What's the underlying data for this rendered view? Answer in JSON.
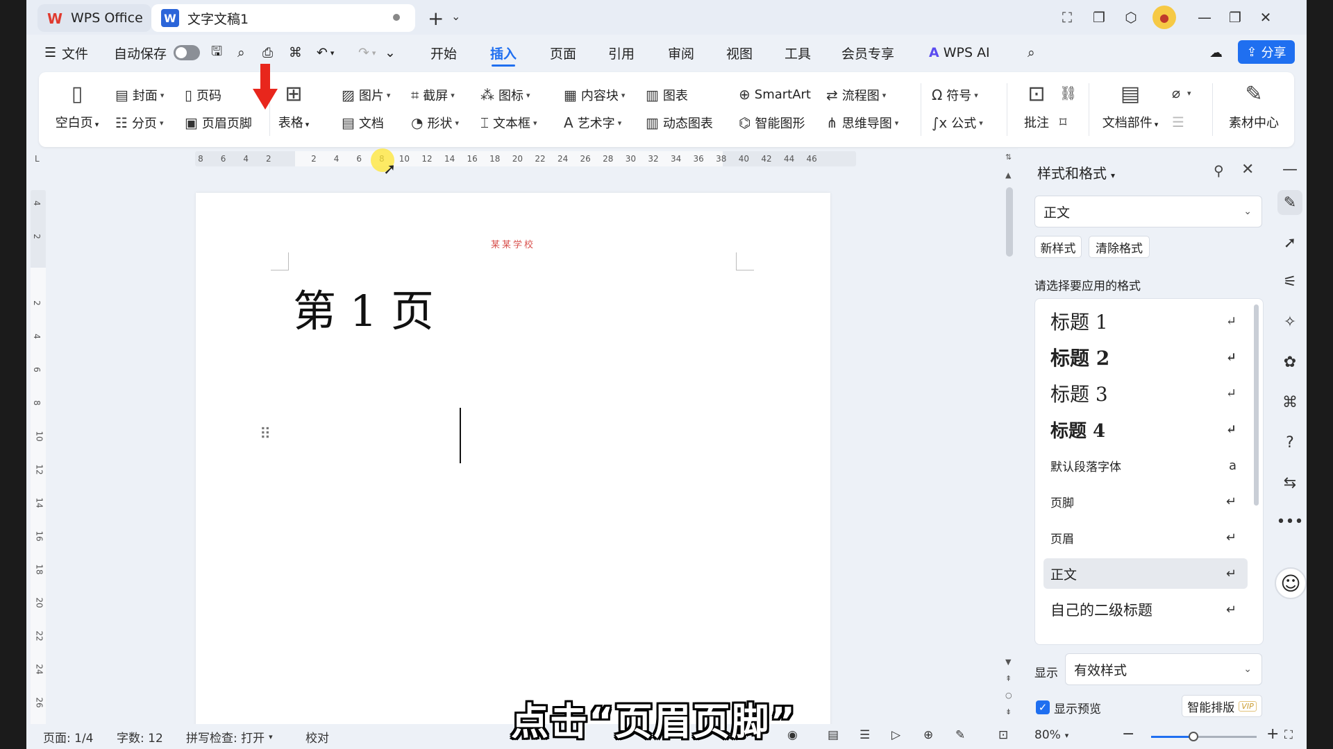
{
  "titlebar": {
    "home_tab": "WPS Office",
    "doc_tab": "文字文稿1"
  },
  "menubar": {
    "file": "文件",
    "autosave": "自动保存",
    "tabs": [
      "开始",
      "插入",
      "页面",
      "引用",
      "审阅",
      "视图",
      "工具",
      "会员专享"
    ],
    "active_tab": "插入",
    "wps_ai": "WPS AI",
    "share": "分享"
  },
  "ribbon": {
    "blank_page": "空白页",
    "cover": "封面",
    "page_number": "页码",
    "page_break": "分页",
    "header_footer": "页眉页脚",
    "table": "表格",
    "picture": "图片",
    "document": "文档",
    "screenshot": "截屏",
    "shape": "形状",
    "icon": "图标",
    "textbox": "文本框",
    "content_block": "内容块",
    "art_text": "艺术字",
    "chart": "图表",
    "dynamic_chart": "动态图表",
    "smartart": "SmartArt",
    "smart_shape": "智能图形",
    "flowchart": "流程图",
    "mindmap": "思维导图",
    "symbol": "符号",
    "formula": "公式",
    "comment": "批注",
    "doc_parts": "文档部件",
    "material_center": "素材中心"
  },
  "ruler": {
    "h_ticks": [
      "8",
      "6",
      "4",
      "2",
      "2",
      "4",
      "6",
      "8",
      "10",
      "12",
      "14",
      "16",
      "18",
      "20",
      "22",
      "24",
      "26",
      "28",
      "30",
      "32",
      "34",
      "36",
      "38",
      "40",
      "42",
      "44",
      "46"
    ],
    "v_ticks": [
      "4",
      "2",
      "2",
      "4",
      "6",
      "8",
      "10",
      "12",
      "14",
      "16",
      "18",
      "20",
      "22",
      "24",
      "26"
    ]
  },
  "document": {
    "header_text": "某某学校",
    "title": "第 1 页"
  },
  "styles_panel": {
    "title": "样式和格式",
    "current_style": "正文",
    "new_style": "新样式",
    "clear_format": "清除格式",
    "prompt": "请选择要应用的格式",
    "items": [
      {
        "label": "标题  1"
      },
      {
        "label": "标题  2"
      },
      {
        "label": "标题  3"
      },
      {
        "label": "标题  4"
      },
      {
        "label": "默认段落字体"
      },
      {
        "label": "页脚"
      },
      {
        "label": "页眉"
      },
      {
        "label": "正文"
      },
      {
        "label": "自己的二级标题"
      }
    ],
    "show_label": "显示",
    "show_value": "有效样式",
    "show_preview": "显示预览",
    "smart_layout": "智能排版",
    "vip": "VIP"
  },
  "statusbar": {
    "page": "页面: 1/4",
    "words": "字数: 12",
    "spell": "拼写检查: 打开",
    "proof": "校对",
    "zoom": "80%",
    "zoom_value": 40
  },
  "subtitle": "点击“页眉页脚”",
  "colors": {
    "accent": "#1f6ff0",
    "arrow": "#e8261c"
  }
}
